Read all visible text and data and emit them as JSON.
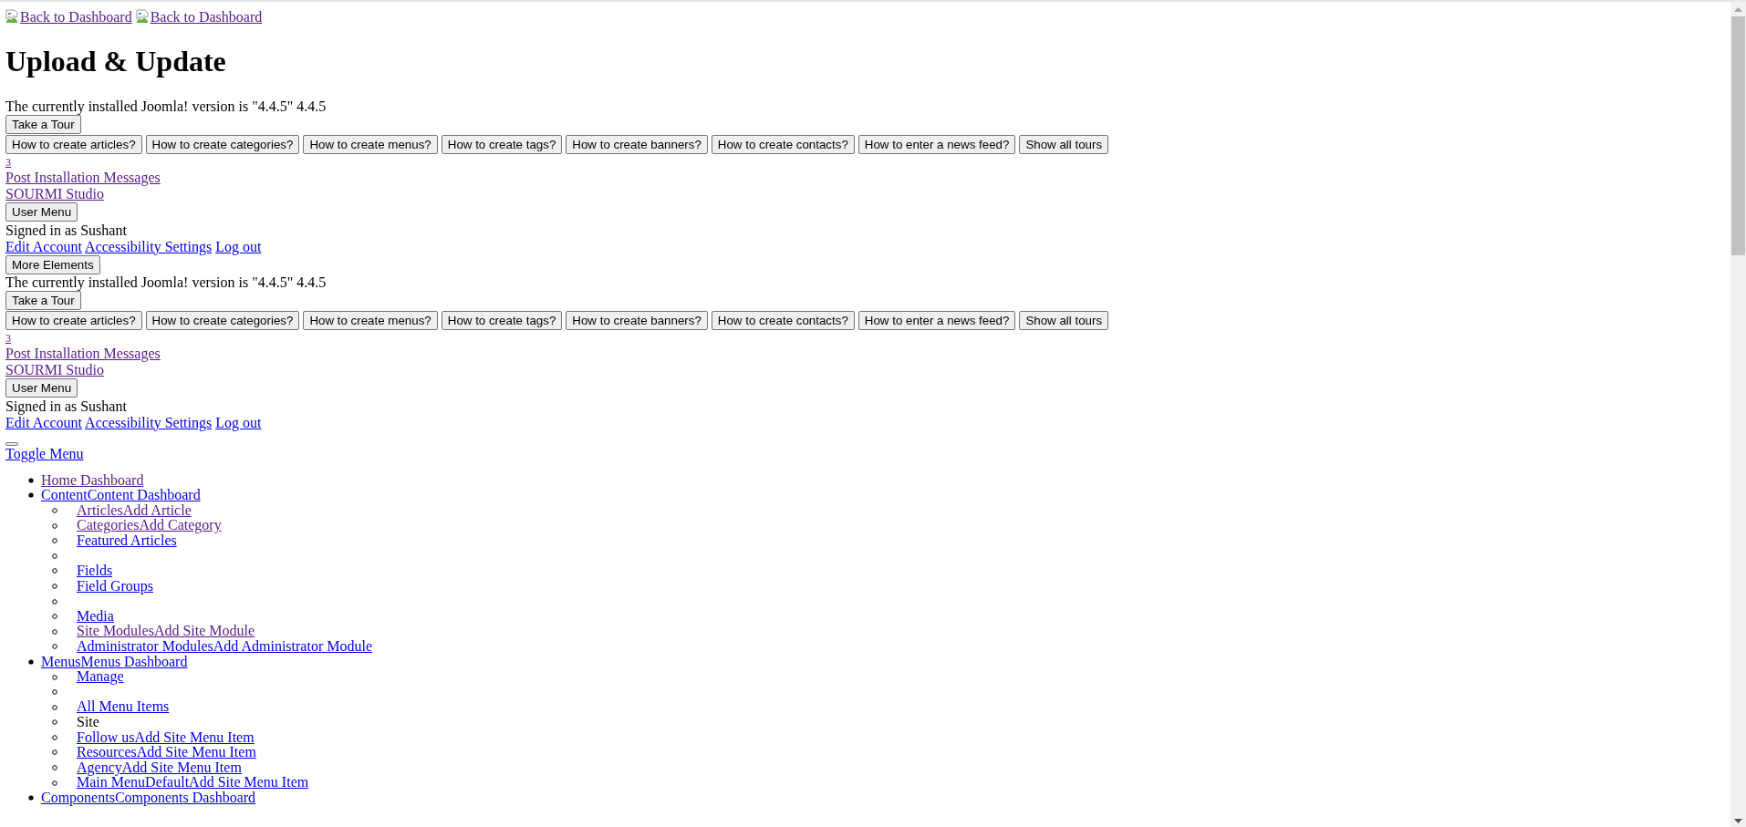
{
  "top_links": [
    {
      "text": "Back to Dashboard",
      "visited": true
    },
    {
      "text": "Back to Dashboard",
      "visited": true
    }
  ],
  "title": "Upload & Update",
  "header_blocks": [
    {
      "version_text": "The currently installed Joomla! version is \"4.4.5\" 4.4.5",
      "tour_button": "Take a Tour",
      "tours": [
        "How to create articles?",
        "How to create categories?",
        "How to create menus?",
        "How to create tags?",
        "How to create banners?",
        "How to create contacts?",
        "How to enter a news feed?",
        "Show all tours"
      ],
      "message_count": "3",
      "messages_link": "Post Installation Messages",
      "site_link": "SOURMI Studio",
      "user_menu_button": "User Menu",
      "signed_in": "Signed in as Sushant",
      "user_links": [
        "Edit Account",
        "Accessibility Settings",
        "Log out"
      ],
      "more_button": "More Elements"
    },
    {
      "version_text": "The currently installed Joomla! version is \"4.4.5\" 4.4.5",
      "tour_button": "Take a Tour",
      "tours": [
        "How to create articles?",
        "How to create categories?",
        "How to create menus?",
        "How to create tags?",
        "How to create banners?",
        "How to create contacts?",
        "How to enter a news feed?",
        "Show all tours"
      ],
      "message_count": "3",
      "messages_link": "Post Installation Messages",
      "site_link": "SOURMI Studio",
      "user_menu_button": "User Menu",
      "signed_in": "Signed in as Sushant",
      "user_links": [
        "Edit Account",
        "Accessibility Settings",
        "Log out"
      ]
    }
  ],
  "toggle_menu": "Toggle Menu",
  "menu": [
    {
      "kind": "link",
      "text": "Home Dashboard",
      "visited": true
    },
    {
      "kind": "link",
      "text": "ContentContent Dashboard",
      "visited": false,
      "children": [
        {
          "kind": "link",
          "text": "ArticlesAdd Article",
          "visited": true
        },
        {
          "kind": "link",
          "text": "CategoriesAdd Category",
          "visited": true
        },
        {
          "kind": "link",
          "text": "Featured Articles",
          "visited": false
        },
        {
          "kind": "empty"
        },
        {
          "kind": "link",
          "text": "Fields",
          "visited": false
        },
        {
          "kind": "link",
          "text": "Field Groups",
          "visited": false
        },
        {
          "kind": "empty"
        },
        {
          "kind": "link",
          "text": "Media",
          "visited": false
        },
        {
          "kind": "link",
          "text": "Site ModulesAdd Site Module",
          "visited": true
        },
        {
          "kind": "link",
          "text": "Administrator ModulesAdd Administrator Module",
          "visited": false
        }
      ]
    },
    {
      "kind": "link",
      "text": "MenusMenus Dashboard",
      "visited": false,
      "children": [
        {
          "kind": "link",
          "text": "Manage",
          "visited": false
        },
        {
          "kind": "empty"
        },
        {
          "kind": "link",
          "text": "All Menu Items",
          "visited": false
        },
        {
          "kind": "text",
          "text": "Site"
        },
        {
          "kind": "link",
          "text": "Follow usAdd Site Menu Item",
          "visited": false
        },
        {
          "kind": "link",
          "text": "ResourcesAdd Site Menu Item",
          "visited": false
        },
        {
          "kind": "link",
          "text": "AgencyAdd Site Menu Item",
          "visited": false
        },
        {
          "kind": "link",
          "text": "Main MenuDefaultAdd Site Menu Item",
          "visited": false
        }
      ]
    },
    {
      "kind": "link",
      "text": "ComponentsComponents Dashboard",
      "visited": false
    }
  ]
}
